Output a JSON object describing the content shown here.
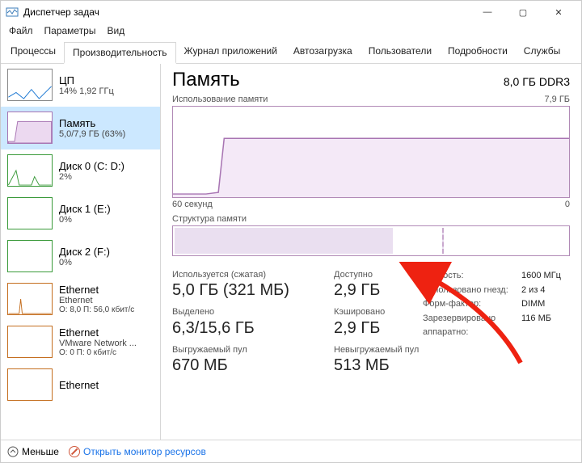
{
  "window": {
    "title": "Диспетчер задач",
    "controls": {
      "min": "—",
      "max": "▢",
      "close": "✕"
    }
  },
  "menu": {
    "file": "Файл",
    "params": "Параметры",
    "view": "Вид"
  },
  "tabs": {
    "processes": "Процессы",
    "perf": "Производительность",
    "apphist": "Журнал приложений",
    "startup": "Автозагрузка",
    "users": "Пользователи",
    "details": "Подробности",
    "services": "Службы"
  },
  "sidebar": {
    "items": [
      {
        "title": "ЦП",
        "sub": "14%  1,92 ГГц"
      },
      {
        "title": "Память",
        "sub": "5,0/7,9 ГБ (63%)"
      },
      {
        "title": "Диск 0 (C: D:)",
        "sub": "2%"
      },
      {
        "title": "Диск 1 (E:)",
        "sub": "0%"
      },
      {
        "title": "Диск 2 (F:)",
        "sub": "0%"
      },
      {
        "title": "Ethernet",
        "sub": "Ethernet",
        "sub2": "О: 8,0 П: 56,0 кбит/с"
      },
      {
        "title": "Ethernet",
        "sub": "VMware Network ...",
        "sub2": "О: 0 П: 0 кбит/с"
      },
      {
        "title": "Ethernet",
        "sub": ""
      }
    ]
  },
  "main": {
    "title": "Память",
    "right": "8,0 ГБ DDR3",
    "usage_label": "Использование памяти",
    "usage_max": "7,9 ГБ",
    "x_left": "60 секунд",
    "x_right": "0",
    "struct_label": "Структура памяти",
    "inuse_label": "Используется (сжатая)",
    "inuse_val": "5,0 ГБ (321 МБ)",
    "avail_label": "Доступно",
    "avail_val": "2,9 ГБ",
    "commit_label": "Выделено",
    "commit_val": "6,3/15,6 ГБ",
    "cached_label": "Кэшировано",
    "cached_val": "2,9 ГБ",
    "paged_label": "Выгружаемый пул",
    "paged_val": "670 МБ",
    "nonpaged_label": "Невыгружаемый пул",
    "nonpaged_val": "513 МБ",
    "speed_label": "Скорость:",
    "speed_val": "1600 МГц",
    "slots_label": "Использовано гнезд:",
    "slots_val": "2 из 4",
    "ff_label": "Форм-фактор:",
    "ff_val": "DIMM",
    "hw_label": "Зарезервировано аппаратно:",
    "hw_val": "116 МБ"
  },
  "footer": {
    "less": "Меньше",
    "link": "Открыть монитор ресурсов"
  },
  "chart_data": {
    "type": "area",
    "title": "Использование памяти",
    "ylim": [
      0,
      7.9
    ],
    "ylabel": "ГБ",
    "xlabel": "секунд",
    "xlim": [
      60,
      0
    ],
    "series": [
      {
        "name": "Использование памяти",
        "x": [
          60,
          55,
          52,
          50,
          48,
          40,
          30,
          20,
          10,
          0
        ],
        "values": [
          0.3,
          0.3,
          0.4,
          4.9,
          5.0,
          5.0,
          5.0,
          5.0,
          5.0,
          5.0
        ]
      }
    ]
  }
}
